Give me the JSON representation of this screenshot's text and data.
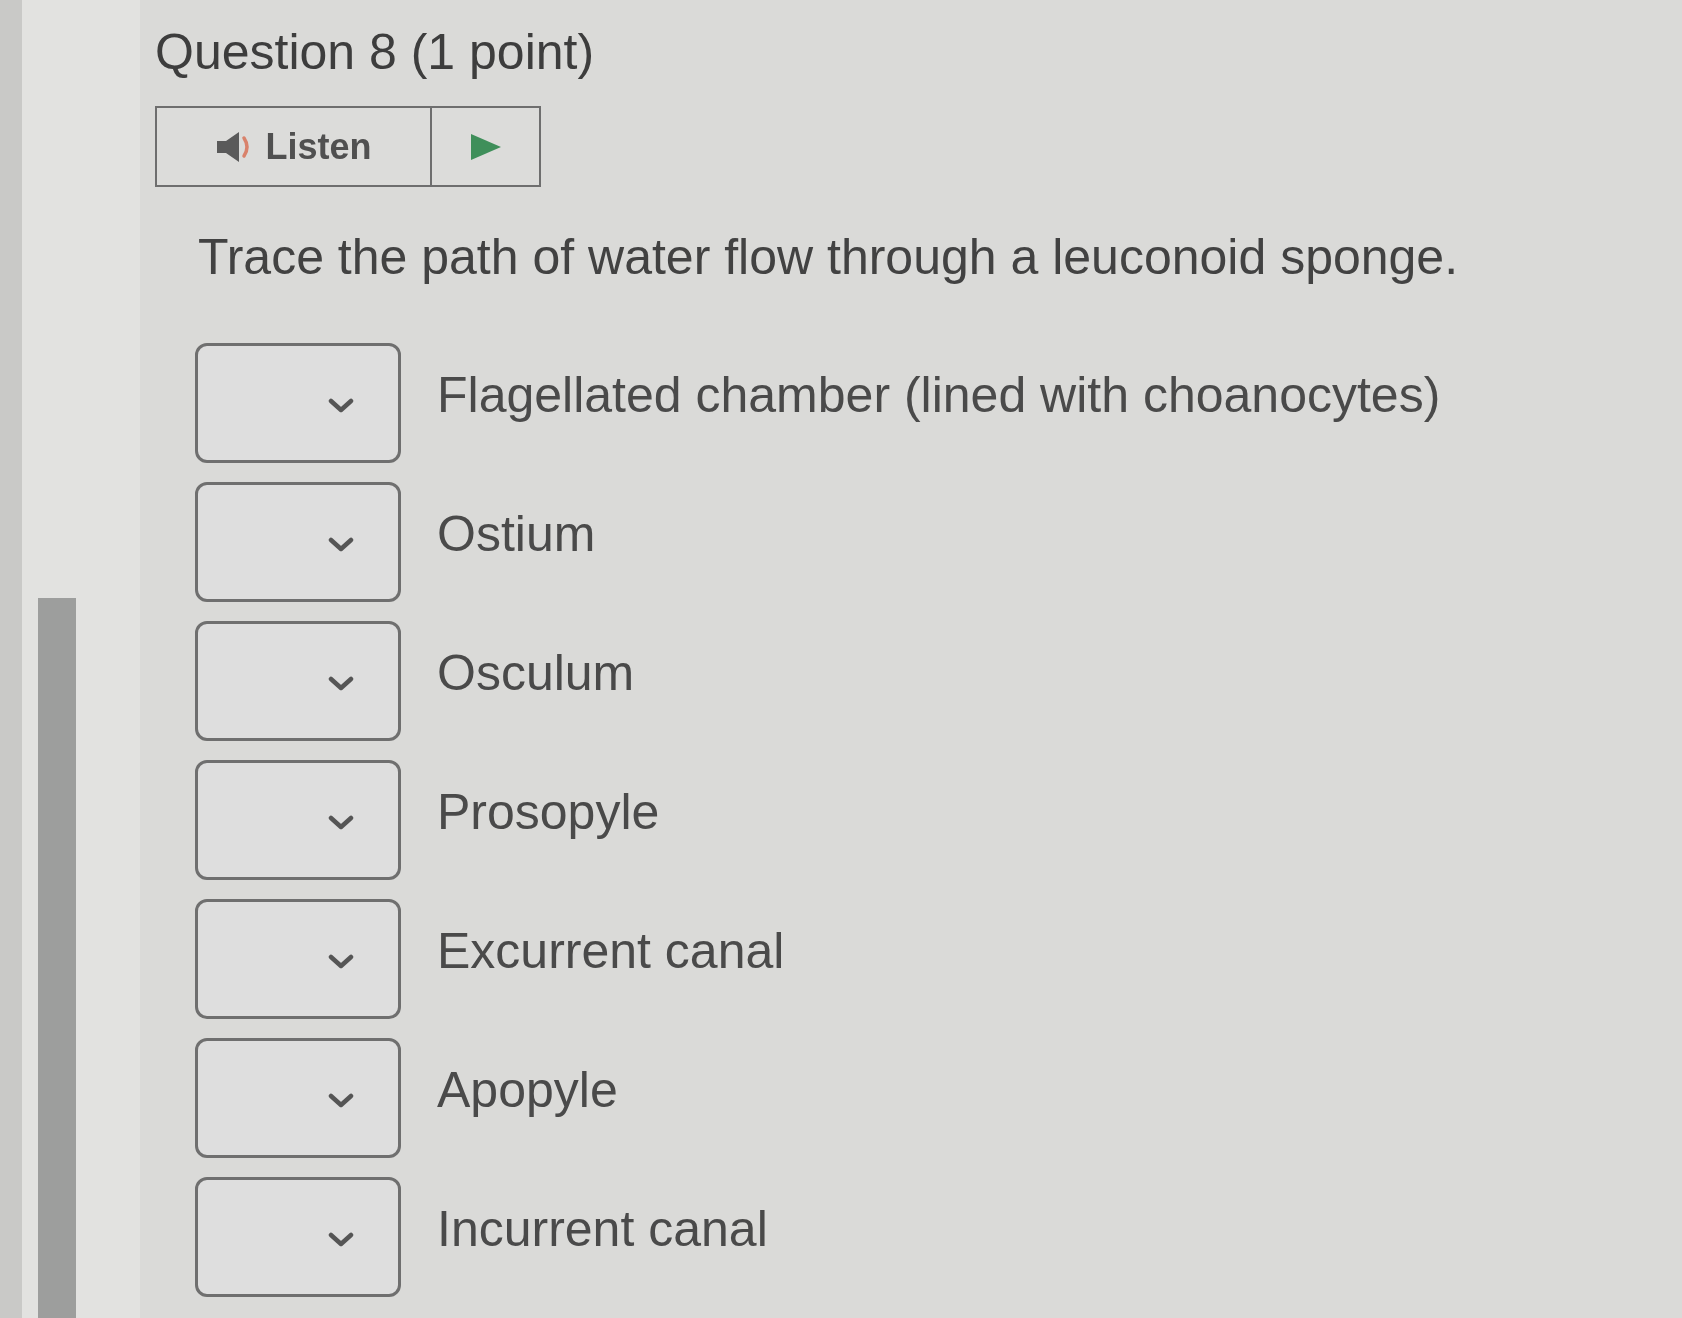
{
  "question": {
    "title": "Question 8 (1 point)"
  },
  "listen": {
    "label": "Listen"
  },
  "prompt": "Trace the path of water flow through a leuconoid sponge.",
  "items": [
    {
      "label": "Flagellated chamber (lined with choanocytes)"
    },
    {
      "label": "Ostium"
    },
    {
      "label": "Osculum"
    },
    {
      "label": "Prosopyle"
    },
    {
      "label": "Excurrent canal"
    },
    {
      "label": "Apopyle"
    },
    {
      "label": "Incurrent canal"
    }
  ]
}
